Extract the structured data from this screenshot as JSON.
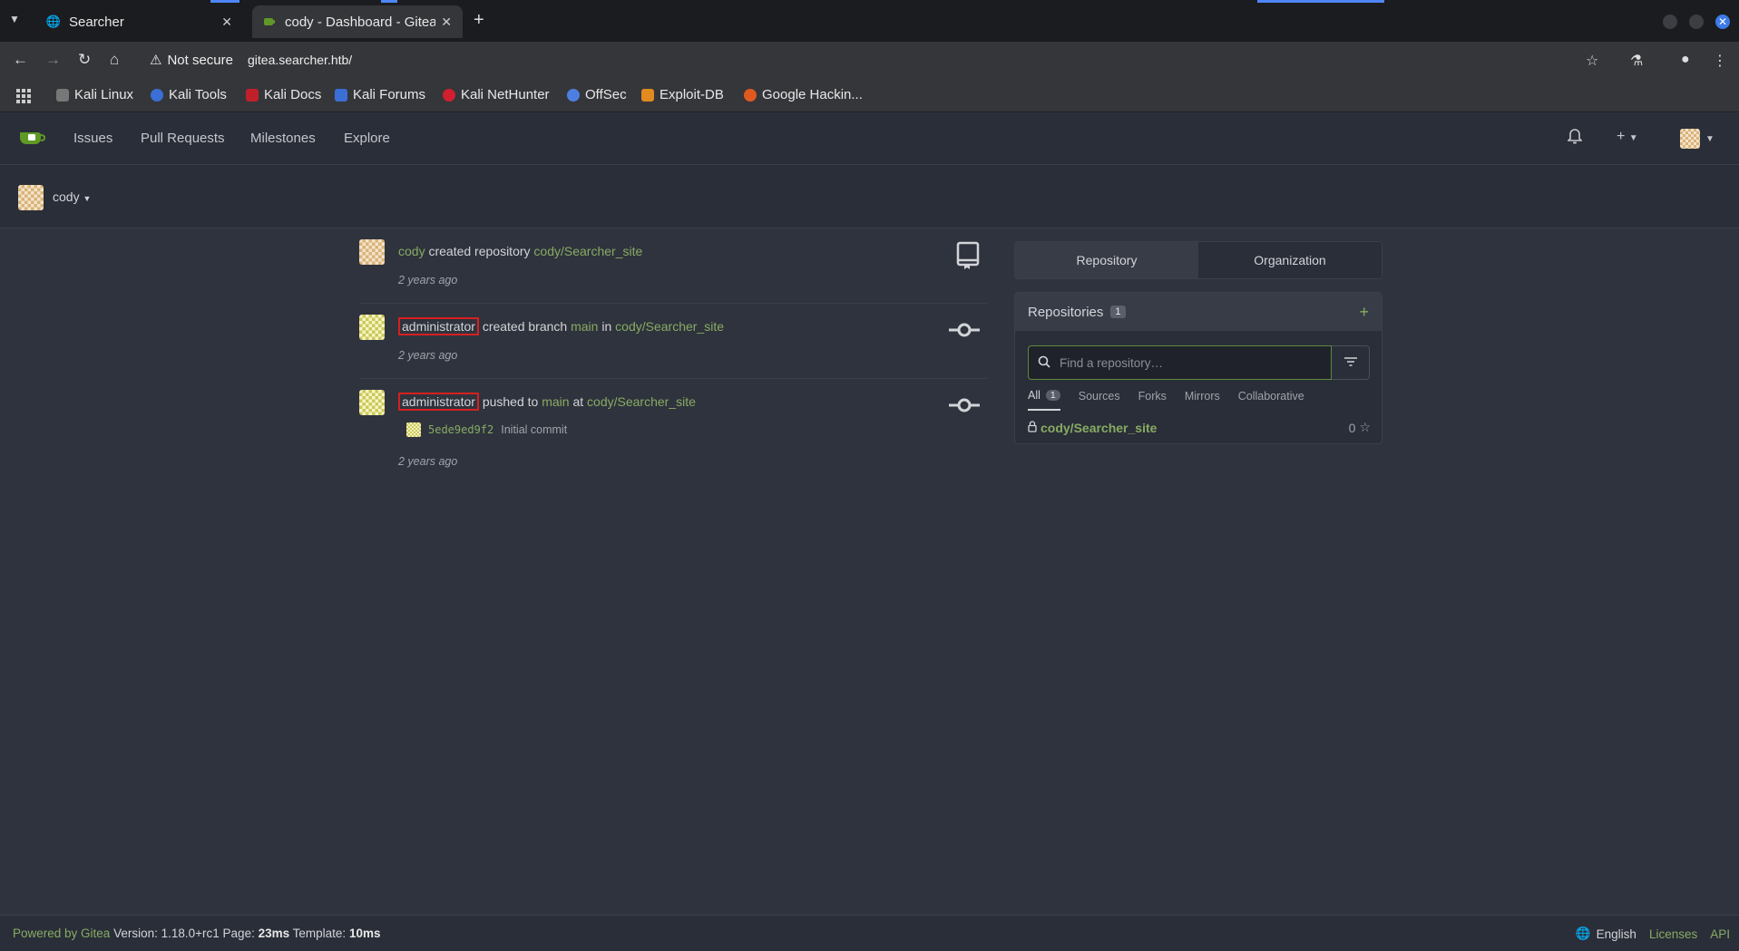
{
  "browser": {
    "tabs": [
      {
        "title": "Searcher",
        "favicon": "globe-icon",
        "active": false
      },
      {
        "title": "cody - Dashboard - Gitea",
        "favicon": "gitea-icon",
        "active": true
      }
    ],
    "security_label": "Not secure",
    "url": "gitea.searcher.htb/",
    "bookmarks": [
      {
        "label": "Kali Linux",
        "color": "#c8c8c8"
      },
      {
        "label": "Kali Tools",
        "color": "#3b6fd6"
      },
      {
        "label": "Kali Docs",
        "color": "#c0202a"
      },
      {
        "label": "Kali Forums",
        "color": "#3b6fd6"
      },
      {
        "label": "Kali NetHunter",
        "color": "#d02030"
      },
      {
        "label": "OffSec",
        "color": "#4d7fe0"
      },
      {
        "label": "Exploit-DB",
        "color": "#e08a20"
      },
      {
        "label": "Google Hackin...",
        "color": "#e05a20"
      }
    ]
  },
  "gitea": {
    "nav": {
      "items": [
        "Issues",
        "Pull Requests",
        "Milestones",
        "Explore"
      ]
    },
    "context_user": "cody",
    "feed": [
      {
        "actor": "cody",
        "action": "created repository",
        "repo": "cody/Searcher_site",
        "time": "2 years ago",
        "icon": "repo-icon"
      },
      {
        "actor": "administrator",
        "action": "created branch",
        "branch": "main",
        "preposition": "in",
        "repo": "cody/Searcher_site",
        "time": "2 years ago",
        "icon": "commit-icon"
      },
      {
        "actor": "administrator",
        "action": "pushed to",
        "branch": "main",
        "preposition": "at",
        "repo": "cody/Searcher_site",
        "commit_sha": "5ede9ed9f2",
        "commit_message": "Initial commit",
        "time": "2 years ago",
        "icon": "commit-icon"
      }
    ],
    "panel": {
      "tabs": [
        "Repository",
        "Organization"
      ],
      "header": "Repositories",
      "count": "1",
      "search_placeholder": "Find a repository…",
      "filters": [
        "All",
        "Sources",
        "Forks",
        "Mirrors",
        "Collaborative"
      ],
      "all_count": "1",
      "repos": [
        {
          "name": "cody/Searcher_site",
          "stars": "0"
        }
      ]
    },
    "footer": {
      "powered_by": "Powered by Gitea",
      "version": "Version: 1.18.0+rc1",
      "page_label": "Page:",
      "page_time": "23ms",
      "template_label": "Template:",
      "template_time": "10ms",
      "language": "English",
      "licenses": "Licenses",
      "api": "API"
    }
  },
  "colors": {
    "link": "#87ab63",
    "highlight_border": "#d62020",
    "background": "#2f333d"
  }
}
